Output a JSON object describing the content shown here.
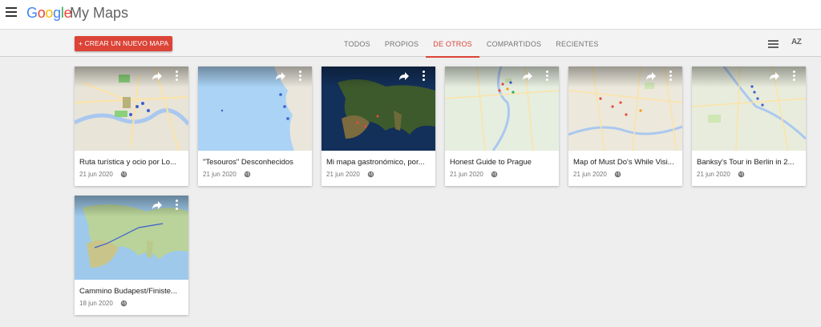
{
  "header": {
    "logo_letters": [
      "G",
      "o",
      "o",
      "g",
      "l",
      "e"
    ],
    "product": "My Maps"
  },
  "toolbar": {
    "create_label": "+ CREAR UN NUEVO MAPA",
    "tabs": [
      {
        "label": "TODOS",
        "active": false
      },
      {
        "label": "PROPIOS",
        "active": false
      },
      {
        "label": "DE OTROS",
        "active": true
      },
      {
        "label": "COMPARTIDOS",
        "active": false
      },
      {
        "label": "RECIENTES",
        "active": false
      }
    ],
    "sort_label": "AZ",
    "accent": "#db4437"
  },
  "maps": [
    {
      "title": "Ruta turística y ocio por Lo...",
      "date": "21 jun 2020",
      "visibility": "globe-icon",
      "thumb": "london-map"
    },
    {
      "title": "\"Tesouros\" Desconhecidos",
      "date": "21 jun 2020",
      "visibility": "globe-icon",
      "thumb": "iberia-coast-map"
    },
    {
      "title": "Mi mapa gastronómico, por...",
      "date": "21 jun 2020",
      "visibility": "globe-icon",
      "thumb": "europe-satellite-map"
    },
    {
      "title": "Honest Guide to Prague",
      "date": "21 jun 2020",
      "visibility": "globe-icon",
      "thumb": "prague-map"
    },
    {
      "title": "Map of Must Do's While Visi...",
      "date": "21 jun 2020",
      "visibility": "globe-icon",
      "thumb": "city-map"
    },
    {
      "title": "Banksy's Tour in Berlin in 2...",
      "date": "21 jun 2020",
      "visibility": "globe-icon",
      "thumb": "berlin-map"
    },
    {
      "title": "Cammino Budapest/Finiste...",
      "date": "18 jun 2020",
      "visibility": "globe-icon",
      "thumb": "europe-terrain-map"
    }
  ]
}
